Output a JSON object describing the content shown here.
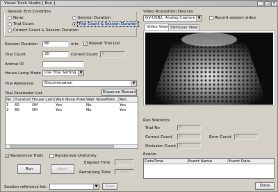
{
  "app": {
    "title": "Visual Track Studio [ Run ]"
  },
  "session_end": {
    "group_label": "Session End Condition",
    "options": [
      "None",
      "Trial Count",
      "Correct Count & Session Duration",
      "Session Duration",
      "Trial Count & Session Duration"
    ],
    "selected": "Trial Count & Session Duration"
  },
  "form": {
    "session_duration_label": "Session Duration",
    "session_duration_value": "60",
    "session_duration_unit": "min.",
    "repeat_trial_list_label": "Repeat Trial List",
    "repeat_trial_list_checked": true,
    "trial_count_label": "Trial Count",
    "trial_count_value": "20",
    "correct_count_label": "Correct Count",
    "correct_count_value": "0",
    "animal_id_label": "Animal ID",
    "animal_id_value": "",
    "house_lamp_label": "House Lamp Mode",
    "house_lamp_value": "Use Trial Setting",
    "trial_reference_label": "Trial Reference",
    "trial_reference_value": "Discrimination"
  },
  "trial_list": {
    "label": "Trial Parameter List",
    "dispense_reward": "Dispense Reward",
    "columns": [
      "No",
      "Duration",
      "House Lamp",
      "Wait Nose Poke",
      "Wait NosePoke ...",
      "Res"
    ],
    "rows": [
      [
        "1",
        "60",
        "Off",
        "Yes",
        "No",
        "Yes"
      ],
      [
        "2",
        "60",
        "Off",
        "Yes",
        "No",
        "Yes"
      ]
    ]
  },
  "options": {
    "randomize_trials_label": "Randomize Trials",
    "randomize_trials_checked": true,
    "randomize_uniformly_label": "Randomize Uniformly",
    "randomize_uniformly_checked": false
  },
  "run": {
    "run_label": "Run",
    "abort_label": "Abort",
    "elapsed_label": "Elapsed Time",
    "elapsed_value": "--:--",
    "remaining_label": "Remaining Time",
    "remaining_value": "--:--"
  },
  "video": {
    "group_label": "Video Acquisition Devices",
    "device_value": "GV-USB2, Analog Capture",
    "record_label": "Record session video",
    "record_checked": false,
    "tabs": [
      "Video View",
      "Stimulus View"
    ],
    "active_tab": "Video View"
  },
  "stats": {
    "group_label": "Run Statistics",
    "trial_no_label": "Trial No",
    "trial_no_value": "0",
    "correct_count_label": "Correct Count",
    "correct_count_value": "0",
    "error_count_label": "Error Count",
    "error_count_value": "0",
    "omission_count_label": "Omission Count",
    "omission_count_value": "0"
  },
  "events": {
    "group_label": "Events",
    "columns": [
      "DateTime",
      "Event Name",
      "Event Data"
    ]
  },
  "footer": {
    "session_ref_label": "Session reference list:",
    "session_ref_value": "",
    "save_label": "Save",
    "done_label": "Done"
  },
  "colors": {
    "background": "#d4d0c8",
    "selection": "#c7d7f0"
  }
}
